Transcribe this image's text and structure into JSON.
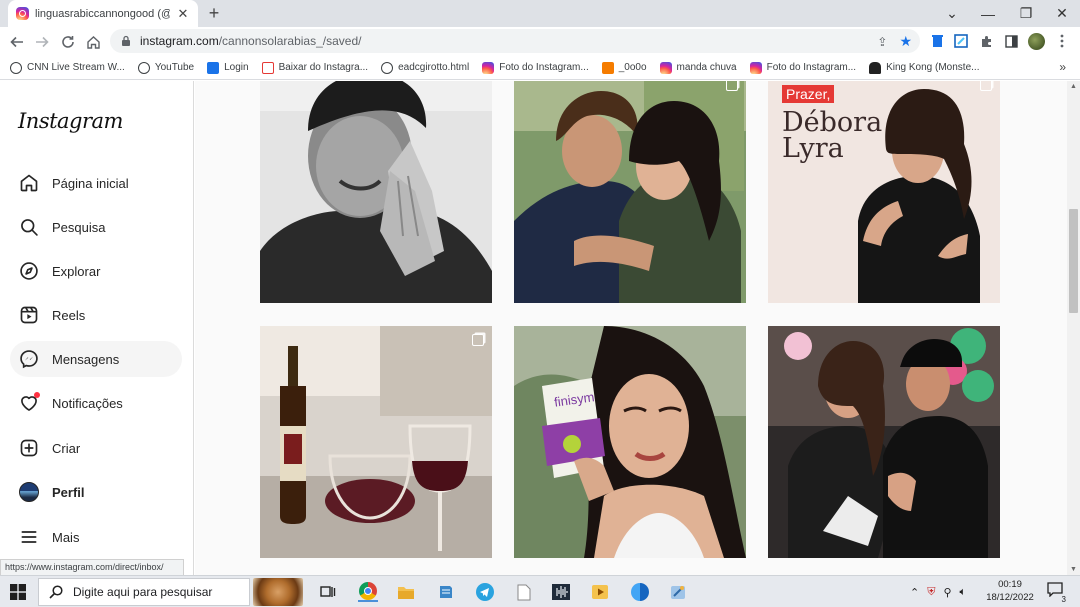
{
  "browser": {
    "tab_title": "linguasrabiccannongood (@cann",
    "url_domain": "instagram.com",
    "url_path": "/cannonsolarabias_/saved/",
    "status_url": "https://www.instagram.com/direct/inbox/"
  },
  "bookmarks": [
    {
      "label": "CNN Live Stream W...",
      "icon": "globe-icon",
      "color": "#3c4043"
    },
    {
      "label": "YouTube",
      "icon": "globe-icon",
      "color": "#3c4043"
    },
    {
      "label": "Login",
      "icon": "g-icon",
      "color": "#1a73e8"
    },
    {
      "label": "Baixar do Instagra...",
      "icon": "download-icon",
      "color": "#e53935"
    },
    {
      "label": "eadcgirotto.html",
      "icon": "globe-icon",
      "color": "#3c4043"
    },
    {
      "label": "Foto do Instagram...",
      "icon": "instagram-icon",
      "color": "#d6249f"
    },
    {
      "label": "_0o0o",
      "icon": "blogger-icon",
      "color": "#f57c00"
    },
    {
      "label": "manda chuva",
      "icon": "instagram-icon",
      "color": "#d6249f"
    },
    {
      "label": "Foto do Instagram...",
      "icon": "instagram-icon",
      "color": "#d6249f"
    },
    {
      "label": "King Kong (Monste...",
      "icon": "kong-icon",
      "color": "#222222"
    }
  ],
  "sidebar": {
    "logo": "Instagram",
    "items": [
      {
        "label": "Página inicial",
        "icon": "home-icon"
      },
      {
        "label": "Pesquisa",
        "icon": "search-icon"
      },
      {
        "label": "Explorar",
        "icon": "compass-icon"
      },
      {
        "label": "Reels",
        "icon": "reels-icon"
      },
      {
        "label": "Mensagens",
        "icon": "messenger-icon"
      },
      {
        "label": "Notificações",
        "icon": "heart-icon"
      },
      {
        "label": "Criar",
        "icon": "plus-square-icon"
      },
      {
        "label": "Perfil",
        "icon": "avatar-icon"
      },
      {
        "label": "Mais",
        "icon": "menu-icon"
      }
    ]
  },
  "posts": {
    "post3_tag": "Prazer,",
    "post3_line1": "Débora",
    "post3_line2": "Lyra",
    "post5_brand": "finisym"
  },
  "taskbar": {
    "search_placeholder": "Digite aqui para pesquisar",
    "time": "00:19",
    "date": "18/12/2022",
    "notifications": "3"
  },
  "colors": {
    "instagram_notif": "#ff3040",
    "chrome_bar": "#dee1e6",
    "taskbar": "#e6e9ee"
  }
}
